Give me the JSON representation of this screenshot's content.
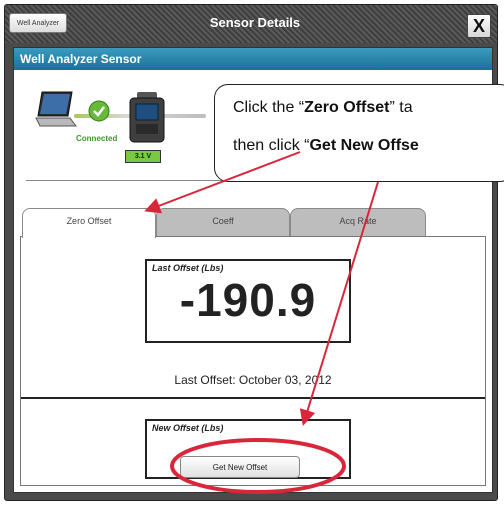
{
  "window": {
    "app_button_label": "Well Analyzer",
    "title": "Sensor Details",
    "close_label": "X"
  },
  "panel": {
    "header": "Well Analyzer Sensor",
    "status_text": "Connected",
    "voltage": "3.1 V"
  },
  "tabs": [
    {
      "label": "Zero Offset",
      "active": true
    },
    {
      "label": "Coeff",
      "active": false
    },
    {
      "label": "Acq Rate",
      "active": false
    }
  ],
  "last_offset": {
    "title": "Last Offset (Lbs)",
    "value": "-190.9",
    "date_text": "Last Offset: October 03, 2012"
  },
  "new_offset": {
    "title": "New Offset (Lbs)",
    "value": "----"
  },
  "button": {
    "get_new_offset": "Get New Offset"
  },
  "callout": {
    "line1_prefix": "Click the “",
    "line1_bold": "Zero Offset",
    "line1_suffix": "” ta",
    "line2_prefix": "then click “",
    "line2_bold": "Get New Offse"
  },
  "colors": {
    "header_blue": "#1c7097",
    "annotation_red": "#d9263a",
    "connected_green": "#3c9a2a"
  }
}
